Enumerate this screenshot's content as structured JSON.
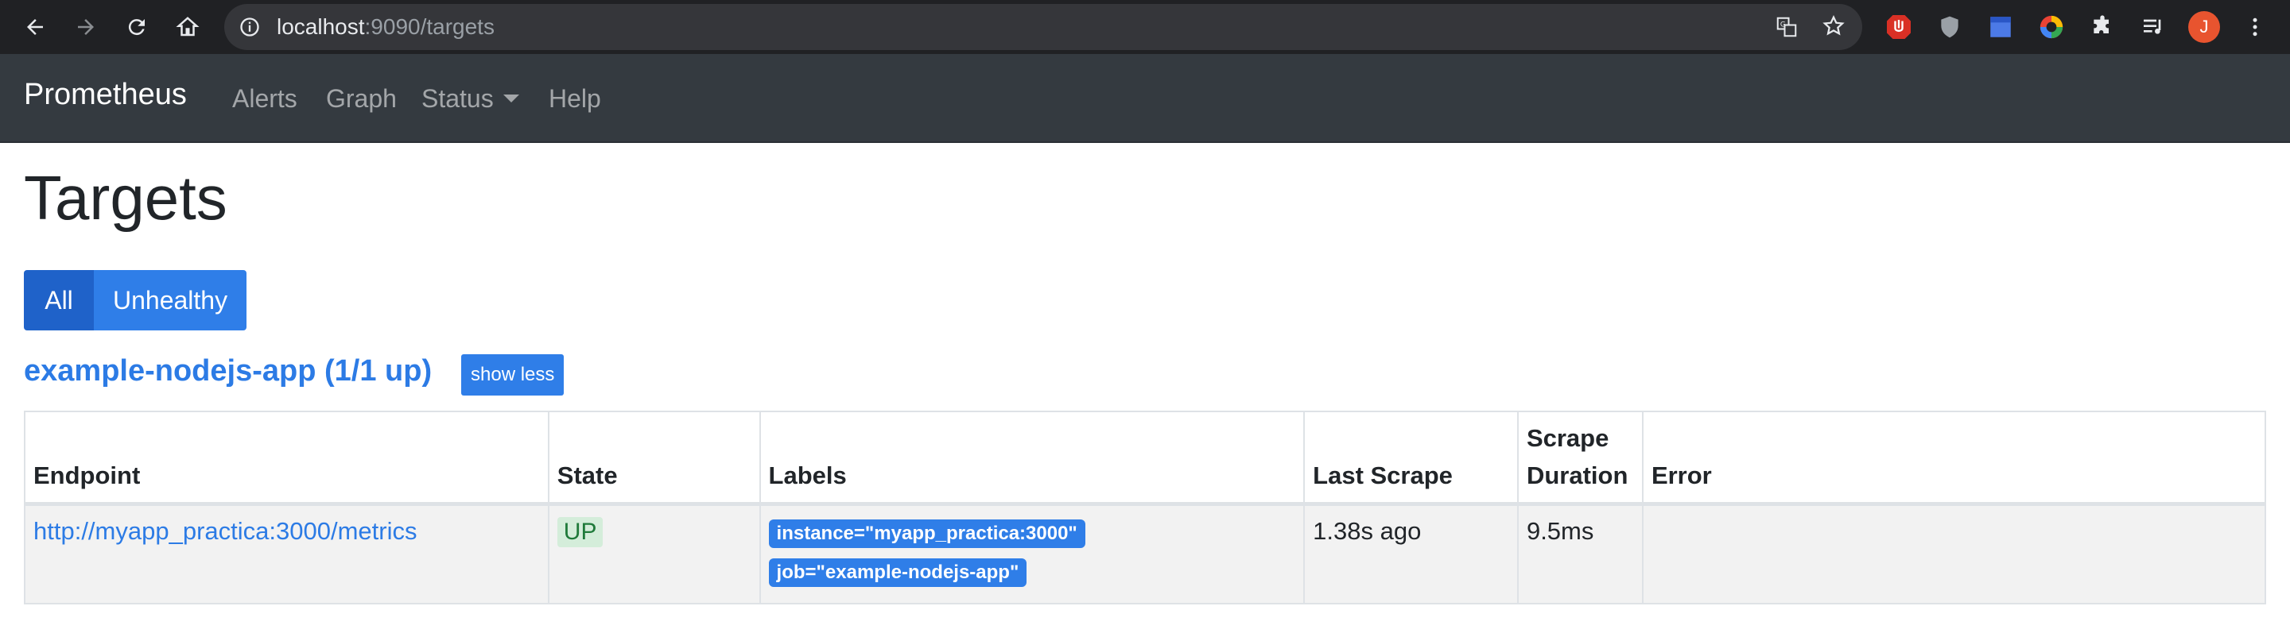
{
  "browser": {
    "url_host": "localhost",
    "url_rest": ":9090/targets",
    "avatar_letter": "J"
  },
  "navbar": {
    "brand": "Prometheus",
    "links": [
      "Alerts",
      "Graph",
      "Status",
      "Help"
    ]
  },
  "page": {
    "title": "Targets",
    "filters": {
      "all": "All",
      "unhealthy": "Unhealthy"
    },
    "job_heading": "example-nodejs-app (1/1 up)",
    "show_less": "show less"
  },
  "table": {
    "headers": {
      "endpoint": "Endpoint",
      "state": "State",
      "labels": "Labels",
      "last_scrape": "Last Scrape",
      "scrape_duration_line1": "Scrape",
      "scrape_duration_line2": "Duration",
      "error": "Error"
    },
    "rows": [
      {
        "endpoint": "http://myapp_practica:3000/metrics",
        "state": "UP",
        "labels": [
          "instance=\"myapp_practica:3000\"",
          "job=\"example-nodejs-app\""
        ],
        "last_scrape": "1.38s ago",
        "scrape_duration": "9.5ms",
        "error": ""
      }
    ]
  },
  "colors": {
    "navbar_bg": "#343a40",
    "link_blue": "#2c7be5",
    "button_blue": "#2f7ee8",
    "up_badge_bg": "#d4edda"
  }
}
